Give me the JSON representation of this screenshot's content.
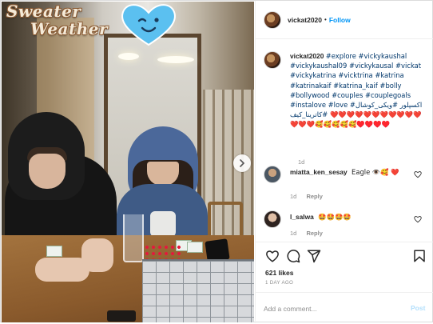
{
  "photo": {
    "title_line_1": "Sweater",
    "title_line_2": "Weather",
    "sticker_icon": "winking-heart-sticker-icon",
    "next_icon": "chevron-right-icon"
  },
  "header": {
    "username": "vickat2020",
    "separator": "•",
    "follow_label": "Follow"
  },
  "caption": {
    "username": "vickat2020",
    "text": "#explore #vickykaushal #vickykaushal09 #vickykausal #vickat #vickykatrina #vicktrina #katrina #katrinakaif #katrina_kaif #bolly #bollywood #couples #couplegoals #instalove #love #اکسپلور #ویکی_کوشال #کاترینا_کیف ❤️❤️❤️❤️❤️❤️❤️❤️❤️❤️❤️❤️❤️❤️🥰🥰🥰🥰🥰♥️♥️♥️♥️",
    "time": "1d"
  },
  "comments": [
    {
      "username": "miatta_ken_sesay",
      "text": "Eagle 👁️🥰 ❤️",
      "time": "1d",
      "reply_label": "Reply"
    },
    {
      "username": "l_salwa",
      "text": "🤩🤩🤩🤩",
      "time": "1d",
      "reply_label": "Reply"
    }
  ],
  "actions": {
    "icons": [
      "heart-icon",
      "comment-icon",
      "share-icon",
      "bookmark-icon"
    ],
    "likes": "621 likes",
    "time_ago": "1 DAY AGO"
  },
  "add_comment": {
    "placeholder": "Add a comment...",
    "post_label": "Post"
  },
  "colors": {
    "link_blue": "#0095f6",
    "hashtag": "#00376b",
    "muted": "#8e8e8e",
    "border": "#dbdbdb",
    "sticker_blue": "#5bc0f0"
  }
}
